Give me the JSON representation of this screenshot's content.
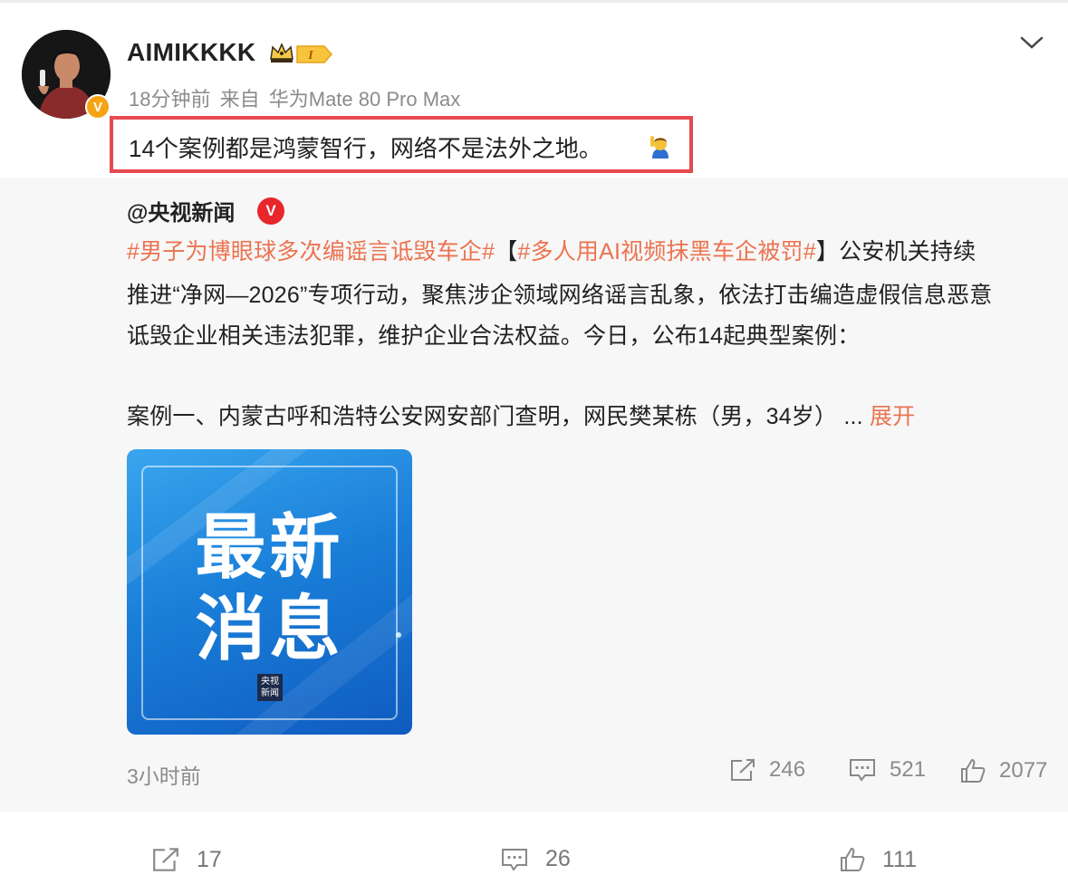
{
  "post": {
    "username": "AIMIKKKK",
    "level_badge": "I",
    "time": "18分钟前",
    "source_prefix": "来自",
    "source_device": "华为Mate 80 Pro Max",
    "text": "14个案例都是鸿蒙智行，网络不是法外之地。",
    "icons": [
      "avatar",
      "verified-v-icon",
      "crown-icon",
      "level-badge-icon",
      "chevron-down-icon",
      "raising-hand-emoji-icon"
    ]
  },
  "repost": {
    "author": "@央视新闻",
    "line1_tag1": "#男子为博眼球多次编谣言诋毁车企#",
    "line1_bracket_open": "【",
    "line1_tag2": "#多人用AI视频抹黑车企被罚#",
    "line1_bracket_close": "】",
    "line1_rest": "公安机关持续",
    "line2": "推进“净网—2026”专项行动，聚焦涉企领域网络谣言乱象，依法打击编造虚假信息恶意",
    "line3": "诋毁企业相关违法犯罪，维护企业合法权益。今日，公布14起典型案例：",
    "line4": "案例一、内蒙古呼和浩特公安网安部门查明，网民樊某栋（男，34岁） ...",
    "expand_label": "展开",
    "image_text_line1": "最新",
    "image_text_line2": "消息",
    "image_logo_line1": "央视",
    "image_logo_line2": "新闻",
    "time": "3小时前",
    "reposts": "246",
    "comments": "521",
    "likes": "2077"
  },
  "actions": {
    "reposts": "17",
    "comments": "26",
    "likes": "111"
  },
  "colors": {
    "accent": "#eb7350",
    "highlight_border": "#e64a4f",
    "verified_orange": "#f6a313",
    "verified_red": "#e8262c",
    "repost_bg": "#f7f7f7"
  }
}
